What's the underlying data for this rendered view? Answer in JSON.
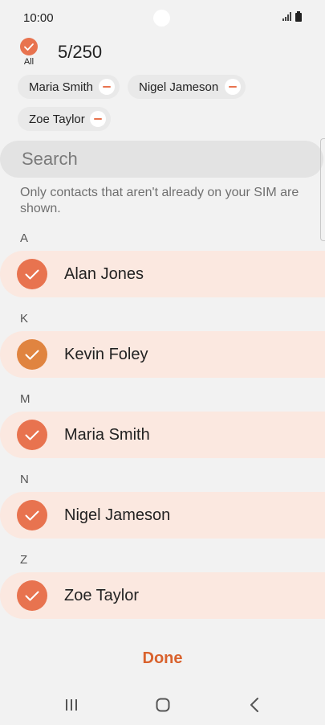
{
  "status_bar": {
    "time": "10:00",
    "icons": [
      "signal-icon",
      "battery-icon"
    ]
  },
  "selection": {
    "all_label": "All",
    "count": "5/250"
  },
  "chips": [
    {
      "name": "Maria Smith"
    },
    {
      "name": "Nigel Jameson"
    },
    {
      "name": "Zoe Taylor"
    }
  ],
  "search": {
    "placeholder": "Search",
    "value": ""
  },
  "notice": "Only contacts that aren't already on your SIM are shown.",
  "sections": [
    {
      "letter": "A",
      "contact": "Alan Jones",
      "checked": true
    },
    {
      "letter": "K",
      "contact": "Kevin Foley",
      "checked": true
    },
    {
      "letter": "M",
      "contact": "Maria Smith",
      "checked": true
    },
    {
      "letter": "N",
      "contact": "Nigel Jameson",
      "checked": true
    },
    {
      "letter": "Z",
      "contact": "Zoe Taylor",
      "checked": true
    }
  ],
  "done_label": "Done",
  "nav_bar": {
    "icons": [
      "recent-apps-icon",
      "home-icon",
      "back-icon"
    ]
  },
  "colors": {
    "accent": "#e8734f",
    "done": "#d9622d",
    "row_bg": "#fbe8e0",
    "background": "#f2f2f2"
  }
}
